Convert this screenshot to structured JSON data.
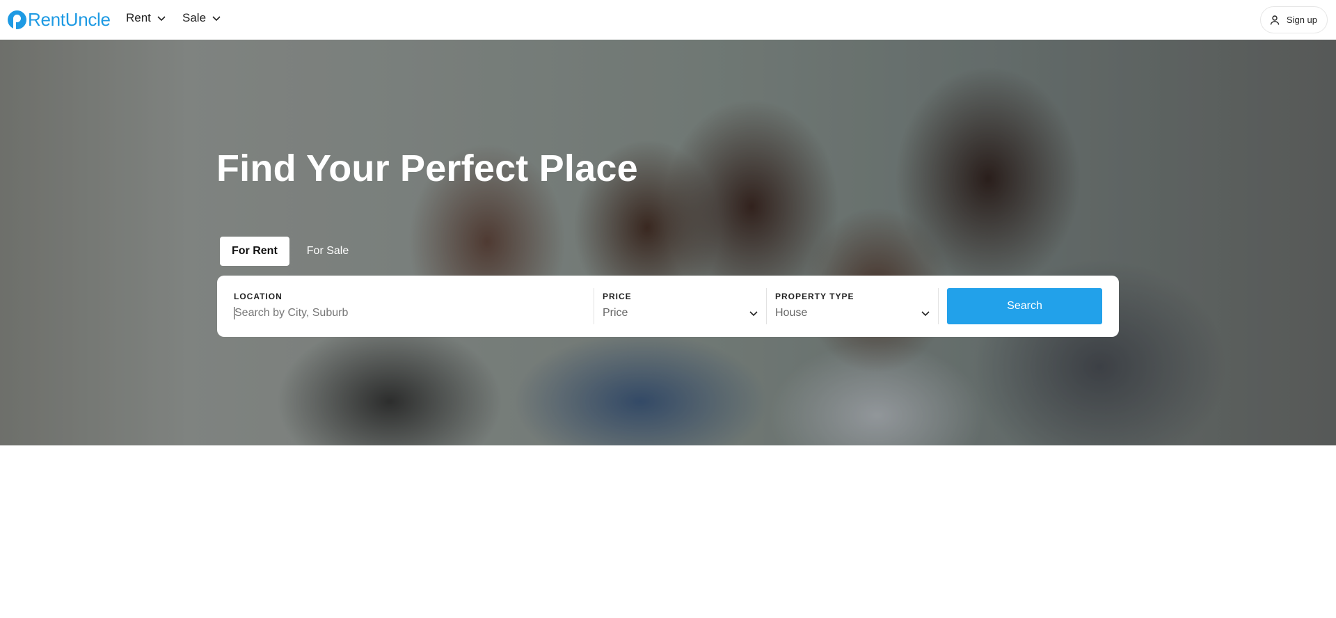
{
  "header": {
    "logo_text": "RentUncle",
    "nav": [
      {
        "label": "Rent"
      },
      {
        "label": "Sale"
      }
    ],
    "signup_label": "Sign up",
    "brand_color": "#1e9ae3"
  },
  "hero": {
    "background_image": "family-selfie-photo",
    "title": "Find Your Perfect Place",
    "tabs": [
      {
        "label": "For Rent",
        "active": true
      },
      {
        "label": "For Sale",
        "active": false
      }
    ],
    "search": {
      "location": {
        "label": "LOCATION",
        "placeholder": "Search by City, Suburb",
        "value": ""
      },
      "price": {
        "label": "PRICE",
        "value": "Price"
      },
      "property_type": {
        "label": "PROPERTY TYPE",
        "value": "House"
      },
      "button_label": "Search",
      "button_color": "#22a1ea"
    }
  }
}
